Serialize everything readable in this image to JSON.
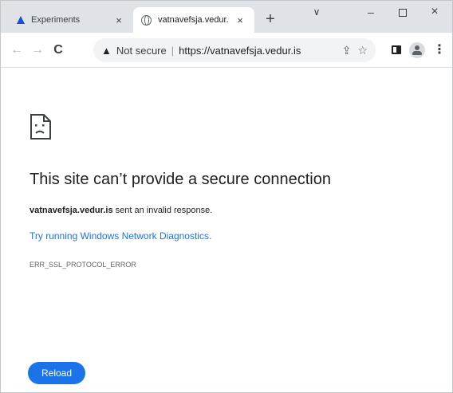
{
  "tabs": [
    {
      "title": "Experiments",
      "close": "×",
      "active": false
    },
    {
      "title": "vatnavefsja.vedur.",
      "close": "×",
      "active": true
    }
  ],
  "new_tab": "+",
  "window_controls": {
    "tab_search": "∨",
    "minimize": "–",
    "close": "×"
  },
  "toolbar": {
    "back": "←",
    "forward": "→",
    "reload": "C",
    "security_warning_icon": "▲",
    "security_label": "Not secure",
    "separator": "|",
    "url": "https://vatnavefsja.vedur.is",
    "share_icon": "⇪",
    "bookmark_icon": "☆",
    "menu_icon": "⋮"
  },
  "error_page": {
    "title": "This site can’t provide a secure connection",
    "host": "vatnavefsja.vedur.is",
    "description_suffix": " sent an invalid response.",
    "link_text": "Try running Windows Network Diagnostics",
    "link_suffix": ".",
    "error_code": "ERR_SSL_PROTOCOL_ERROR",
    "reload_label": "Reload"
  },
  "colors": {
    "accent": "#1a73e8",
    "tabstrip": "#dfe3e7",
    "flask_favicon": "#1a4fd6"
  }
}
